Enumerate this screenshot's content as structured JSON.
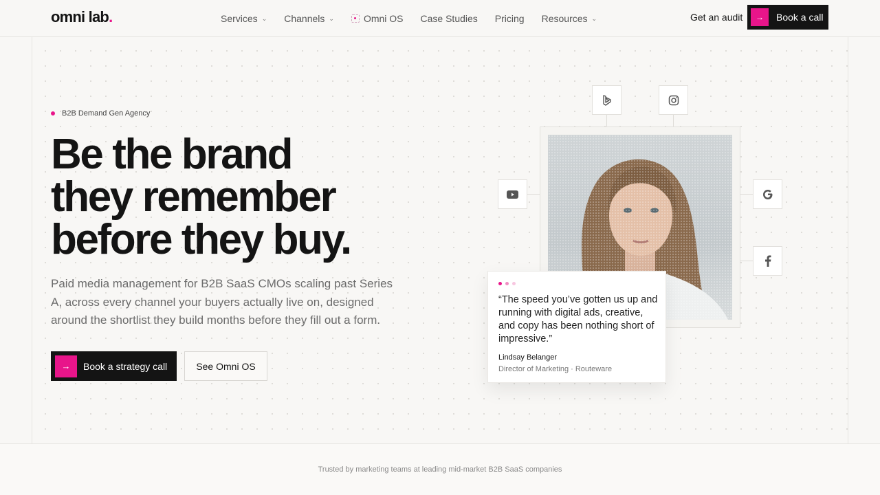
{
  "nav": {
    "logo_text": "omni lab",
    "logo_dot": ".",
    "items": [
      {
        "label": "Services",
        "chevron": true
      },
      {
        "label": "Channels",
        "chevron": true
      },
      {
        "label": "Omni OS",
        "chevron": false,
        "icon": "omni-os-icon"
      },
      {
        "label": "Case Studies",
        "chevron": false
      },
      {
        "label": "Pricing",
        "chevron": false
      },
      {
        "label": "Resources",
        "chevron": true
      }
    ],
    "audit_label": "Get an audit",
    "book_label": "Book a call"
  },
  "hero": {
    "tag": "B2B Demand Gen Agency",
    "headline_lines": [
      "Be the brand",
      "they remember",
      "before they buy."
    ],
    "subtext": "Paid media management for B2B SaaS CMOs scaling past Series A, across every channel your buyers actually live on, designed around the shortlist they build months before they fill out a form.",
    "primary_cta": "Book a strategy call",
    "secondary_cta": "See Omni OS"
  },
  "channels": [
    "bing-icon",
    "instagram-icon",
    "youtube-icon",
    "google-icon",
    "facebook-icon"
  ],
  "testimonial": {
    "quote": "“The speed you’ve gotten us up and running with digital ads, creative, and copy has been nothing short of impressive.”",
    "name": "Lindsay Belanger",
    "role": "Director of Marketing · Routeware"
  },
  "trusted_text": "Trusted by marketing teams at leading mid-market B2B SaaS companies",
  "colors": {
    "accent": "#e8158a",
    "dark": "#141414",
    "background": "#f8f7f5"
  }
}
